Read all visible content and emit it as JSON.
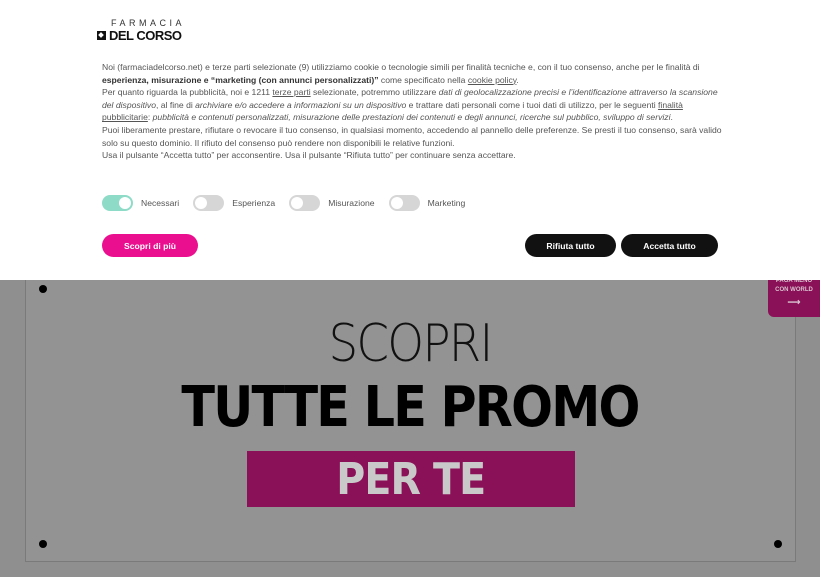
{
  "logo": {
    "top": "FARMACIA",
    "main": "DEL CORSO"
  },
  "consent": {
    "p1_a": "Noi (farmaciadelcorso.net) e terze parti selezionate (9) utilizziamo cookie o tecnologie simili per finalità tecniche e, con il tuo consenso, anche per le finalità di ",
    "p1_bold": "esperienza, misurazione e “marketing (con annunci personalizzati)”",
    "p1_b": " come specificato nella ",
    "p1_link": "cookie policy",
    "p1_c": ".",
    "p2_a": "Per quanto riguarda la pubblicità, noi e 1211 ",
    "p2_link1": "terze parti",
    "p2_b": " selezionate, potremmo utilizzare ",
    "p2_i1": "dati di geolocalizzazione precisi e l’identificazione attraverso la scansione del dispositivo",
    "p2_c": ", al fine di ",
    "p2_i2": "archiviare e/o accedere a informazioni su un dispositivo",
    "p2_d": " e trattare dati personali come i tuoi dati di utilizzo, per le seguenti ",
    "p2_link2": "finalità pubblicitarie",
    "p2_e": ": ",
    "p2_i3": "pubblicità e contenuti personalizzati, misurazione delle prestazioni dei contenuti e degli annunci, ricerche sul pubblico, sviluppo di servizi",
    "p2_f": ".",
    "p3": "Puoi liberamente prestare, rifiutare o revocare il tuo consenso, in qualsiasi momento, accedendo al pannello delle preferenze. Se presti il tuo consenso, sarà valido solo su questo dominio. Il rifiuto del consenso può rendere non disponibili le relative funzioni.",
    "p4": "Usa il pulsante “Accetta tutto” per acconsentire. Usa il pulsante “Rifiuta tutto” per continuare senza accettare."
  },
  "toggles": [
    {
      "label": "Necessari",
      "on": true
    },
    {
      "label": "Esperienza",
      "on": false
    },
    {
      "label": "Misurazione",
      "on": false
    },
    {
      "label": "Marketing",
      "on": false
    }
  ],
  "buttons": {
    "more": "Scopri di più",
    "reject": "Rifiuta tutto",
    "accept": "Accetta tutto"
  },
  "promo": {
    "line1": "SCOPRI",
    "line2": "TUTTE LE PROMO",
    "line3": "PER TE"
  },
  "side_tab": {
    "line1": "PAGA MENO",
    "line2": "CON WORLD",
    "arrow": "⟶"
  },
  "colors": {
    "accent": "#ea0f8f",
    "dark_button": "#111111",
    "toggle_on": "#8edcc7",
    "promo_band": "#8a1057"
  }
}
